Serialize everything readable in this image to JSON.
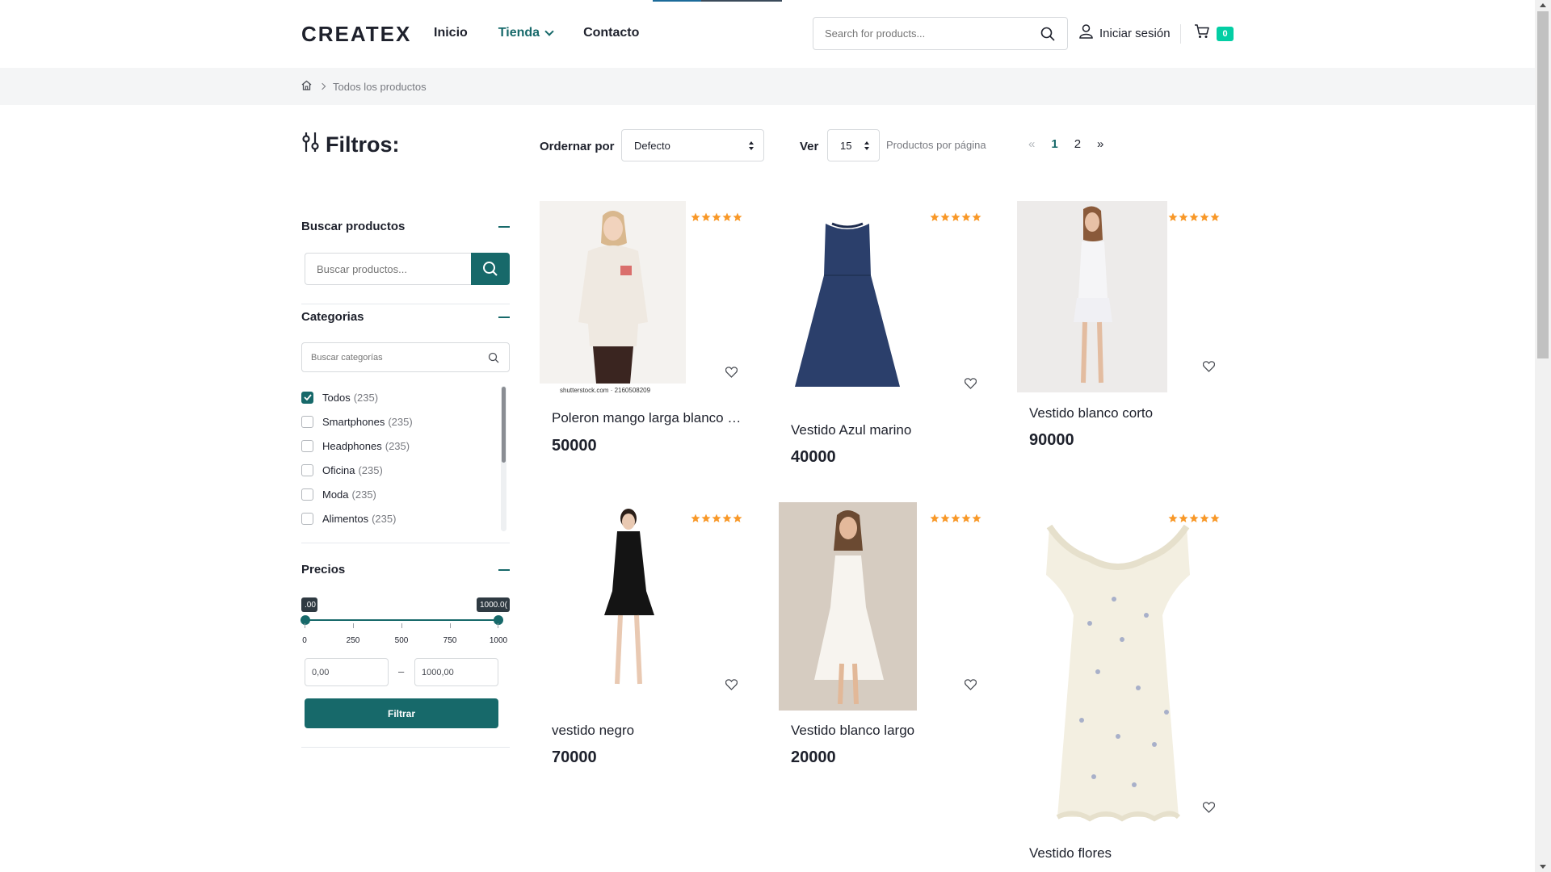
{
  "header": {
    "logo": "CREATEX",
    "nav": [
      {
        "label": "Inicio",
        "active": false
      },
      {
        "label": "Tienda",
        "active": true
      },
      {
        "label": "Contacto",
        "active": false
      }
    ],
    "search_placeholder": "Search for products...",
    "login_label": "Iniciar sesión",
    "cart_count": "0"
  },
  "breadcrumb": {
    "current": "Todos los productos"
  },
  "sidebar": {
    "title": "Filtros:",
    "search_section": {
      "title": "Buscar productos",
      "placeholder": "Buscar productos..."
    },
    "categories": {
      "title": "Categorias",
      "placeholder": "Buscar categorías",
      "items": [
        {
          "label": "Todos",
          "count": "(235)",
          "checked": true
        },
        {
          "label": "Smartphones",
          "count": "(235)",
          "checked": false
        },
        {
          "label": "Headphones",
          "count": "(235)",
          "checked": false
        },
        {
          "label": "Oficina",
          "count": "(235)",
          "checked": false
        },
        {
          "label": "Moda",
          "count": "(235)",
          "checked": false
        },
        {
          "label": "Alimentos",
          "count": "(235)",
          "checked": false
        }
      ]
    },
    "prices": {
      "title": "Precios",
      "tooltip_min": ".00",
      "tooltip_max": "1000.0(",
      "ticks": [
        "0",
        "250",
        "500",
        "750",
        "1000"
      ],
      "min_value": "0,00",
      "max_value": "1000,00",
      "dash": "–",
      "filter_button": "Filtrar"
    }
  },
  "toolbar": {
    "sort_label": "Ordernar por",
    "sort_value": "Defecto",
    "ver_label": "Ver",
    "per_page_value": "15",
    "per_page_label": "Productos por página",
    "pager": {
      "prev": "«",
      "pages": [
        "1",
        "2"
      ],
      "next": "»"
    }
  },
  "products": [
    {
      "title": "Poleron mango larga blanco estampado",
      "price": "50000",
      "watermark": "shutterstock.com · 2160508209",
      "rating": 5
    },
    {
      "title": "Vestido Azul marino",
      "price": "40000",
      "rating": 5
    },
    {
      "title": "Vestido blanco corto",
      "price": "90000",
      "rating": 5
    },
    {
      "title": "vestido negro",
      "price": "70000",
      "rating": 5
    },
    {
      "title": "Vestido blanco largo",
      "price": "20000",
      "rating": 5
    },
    {
      "title": "Vestido flores",
      "price": "",
      "rating": 5
    }
  ],
  "colors": {
    "accent": "#17696a",
    "badge": "#03cea4",
    "star": "#f89828"
  }
}
